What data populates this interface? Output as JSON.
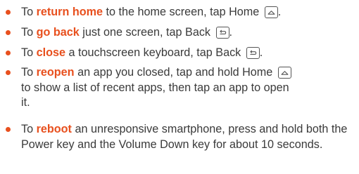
{
  "colors": {
    "accent": "#e8501e",
    "text": "#3a3a3a"
  },
  "icons": {
    "home": "home-key-icon",
    "back": "back-key-icon"
  },
  "items": [
    {
      "pre": "To ",
      "highlight": "return home",
      "post": " to the home screen, tap Home",
      "key": "home",
      "tail": "."
    },
    {
      "pre": "To ",
      "highlight": "go back",
      "post": " just one screen, tap Back",
      "key": "back",
      "tail": "."
    },
    {
      "pre": "To ",
      "highlight": "close",
      "post": " a touchscreen keyboard, tap Back",
      "key": "back",
      "tail": "."
    },
    {
      "pre": "To ",
      "highlight": "reopen",
      "post": " an app you closed, tap and hold Home",
      "key": "home",
      "tail": "to show a list of recent apps, then tap an app to open it."
    },
    {
      "pre": "To ",
      "highlight": "reboot",
      "post": " an unresponsive smartphone, press and hold both the Power key and the Volume Down key for about 10 seconds.",
      "key": null,
      "tail": ""
    }
  ]
}
